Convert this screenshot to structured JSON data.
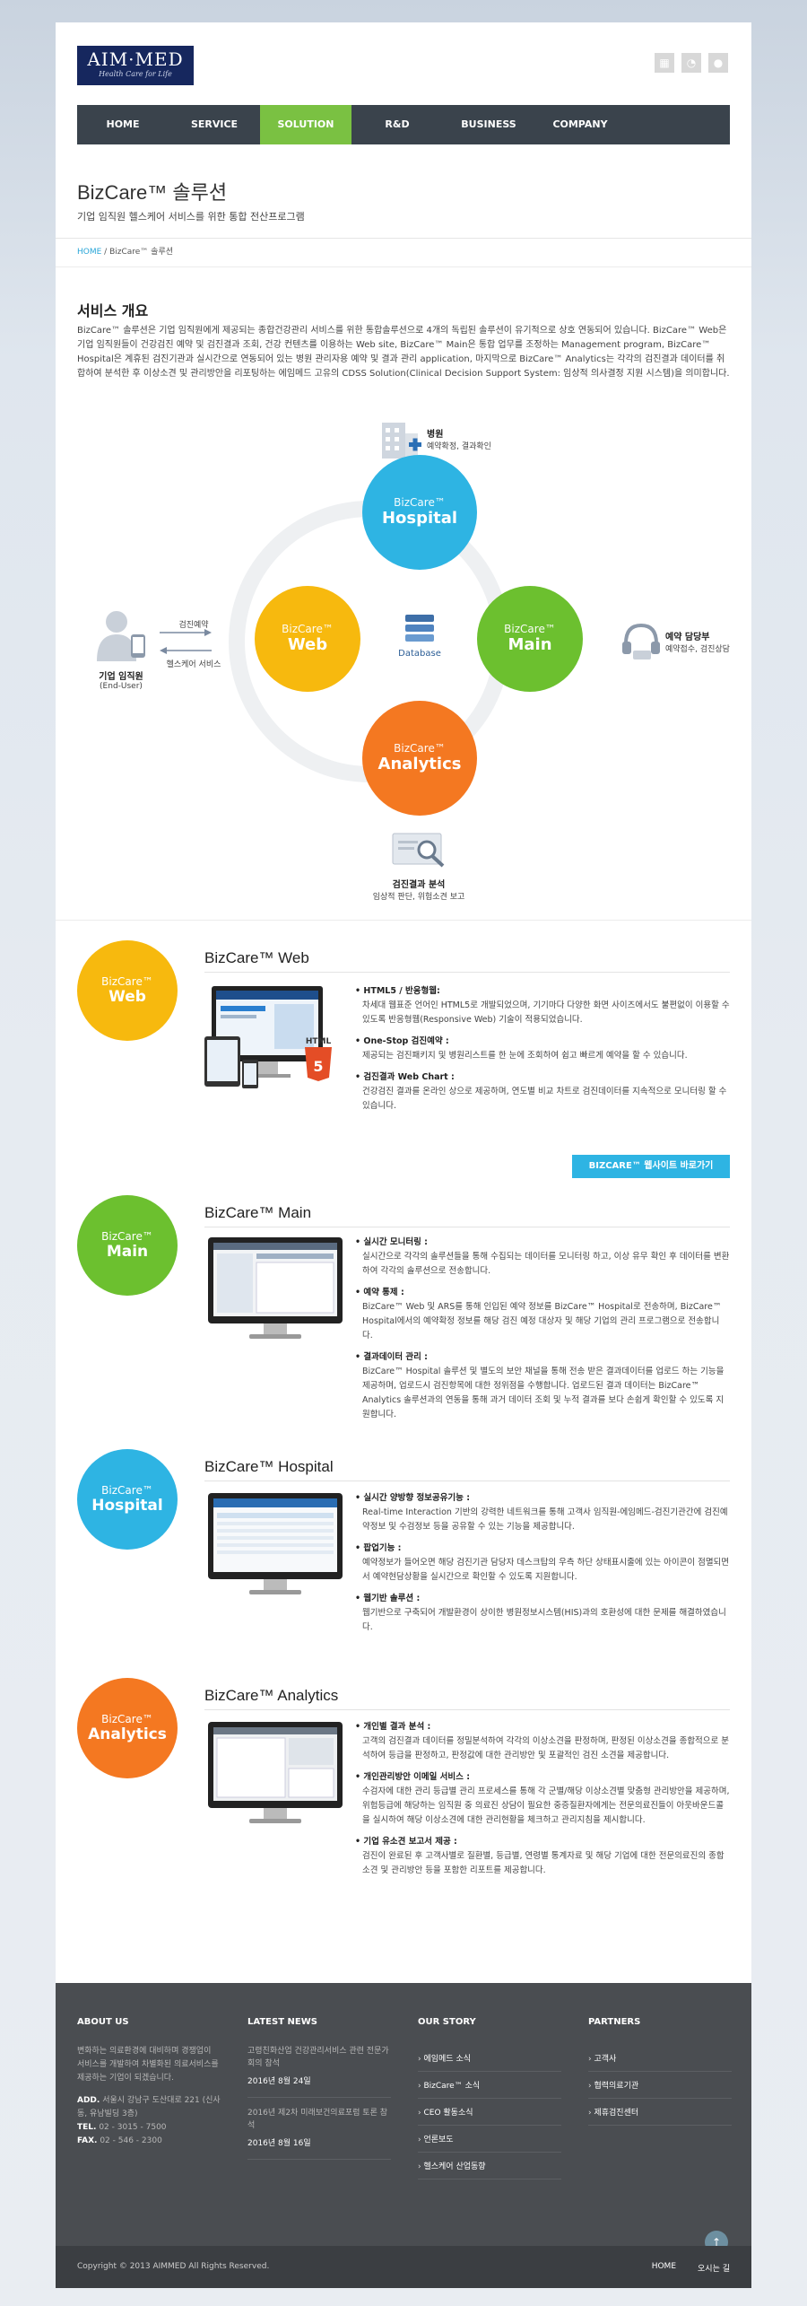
{
  "header": {
    "logo_main": "AIM·MED",
    "logo_sub": "Health Care for Life",
    "icons": [
      "calendar-icon",
      "rss-icon",
      "map-pin-icon"
    ]
  },
  "nav": {
    "items": [
      "HOME",
      "SERVICE",
      "SOLUTION",
      "R&D",
      "BUSINESS",
      "COMPANY"
    ],
    "active": "SOLUTION"
  },
  "page": {
    "title": "BizCare™ 솔루션",
    "subtitle": "기업 임직원 헬스케어 서비스를 위한 통합 전산프로그램",
    "breadcrumb_home": "HOME",
    "breadcrumb_current": " / BizCare™ 솔루션"
  },
  "overview": {
    "heading": "서비스 개요",
    "text": "BizCare™ 솔루션은 기업 임직원에게 제공되는 종합건강관리 서비스를 위한 통합솔루션으로 4개의 독립된 솔루션이 유기적으로 상호 연동되어 있습니다. BizCare™ Web은 기업 임직원들이 건강검진 예약 및 검진결과 조회, 건강 컨텐츠를 이용하는 Web site, BizCare™ Main은 통합 업무를 조정하는 Management program, BizCare™ Hospital은 계휴된 검진기관과 실시간으로 연동되어 있는 병원 관리자용 예약 및 결과 관리 application, 마지막으로 BizCare™ Analytics는 각각의 검진결과 데이터를 취합하여 분석한 후 이상소견 및 관리방안을 리포팅하는 에임메드 고유의 CDSS Solution(Clinical Decision Support System: 임상적 의사결정 지원 시스템)을 의미합니다."
  },
  "diagram": {
    "brand": "BizCare™",
    "hospital": "Hospital",
    "web": "Web",
    "main": "Main",
    "analytics": "Analytics",
    "database": "Database",
    "hospital_label": "병원",
    "hospital_desc": "예약확정, 결과확인",
    "user_label": "기업 임직원",
    "user_sub": "(End-User)",
    "arrow_top": "검진예약",
    "arrow_bottom": "헬스케어 서비스",
    "agent_label": "예약 담당부",
    "agent_desc": "예약접수, 검진상담",
    "analysis_label": "검진결과 분석",
    "analysis_desc": "임상적 판단, 위험소견 보고"
  },
  "sections": {
    "web": {
      "brand": "BizCare™",
      "name": "Web",
      "title": "BizCare™ Web",
      "b1_t": "HTML5 / 반응형웹:",
      "b1_d": "차세대 웹표준 언어인 HTML5로 개발되었으며, 기기마다 다양한 화면 사이즈에서도 불편없이 이용할 수 있도록 반응형웹(Responsive Web) 기술이 적용되었습니다.",
      "b2_t": "One-Stop 검진예약 :",
      "b2_d": "제공되는 검진패키지 및 병원리스트를 한 눈에 조회하여 쉽고 빠르게 예약을 할 수 있습니다.",
      "b3_t": "검진결과 Web Chart :",
      "b3_d": "건강검진 결과를 온라인 상으로 제공하며, 연도별 비교 차트로 검진데이터를 지속적으로 모니터링 할 수 있습니다.",
      "cta": "BIZCARE™ 웹사이트 바로가기"
    },
    "main": {
      "brand": "BizCare™",
      "name": "Main",
      "title": "BizCare™ Main",
      "b1_t": "실시간 모니터링 :",
      "b1_d": "실시간으로 각각의 솔루션들을 통해 수집되는 데이터를 모니터링 하고, 이상 유무 확인 후 데이터를 변환하여 각각의 솔루션으로 전송합니다.",
      "b2_t": "예약 통제 :",
      "b2_d": "BizCare™ Web 및 ARS를 통해 인입된 예약 정보를 BizCare™ Hospital로 전송하며, BizCare™ Hospital에서의 예약확정 정보를 해당 검진 예정 대상자 및 해당 기업의 관리 프로그램으로 전송합니다.",
      "b3_t": "결과데이터 관리 :",
      "b3_d": "BizCare™ Hospital 솔루션 및 별도의 보안 채널을 통해 전송 받은 결과데이터를 업로드 하는 기능을 제공하며, 업로드시 검진항목에 대한 정위점을 수행합니다. 업로드된 결과 데이터는 BizCare™ Analytics 솔루션과의 연동을 통해 과거 데이터 조회 및 누적 결과를 보다 손쉽게 확인할 수 있도록 지원합니다."
    },
    "hospital": {
      "brand": "BizCare™",
      "name": "Hospital",
      "title": "BizCare™ Hospital",
      "b1_t": "실시간 양방향 정보공유기능 :",
      "b1_d": "Real-time Interaction 기반의 강력한 네트워크를 통해 고객사 임직원-에임메드-검진기관간에 검진예약정보 및 수검정보 등을 공유할 수 있는 기능을 제공합니다.",
      "b2_t": "팝업기능 :",
      "b2_d": "예약정보가 들어오면 해당 검진기관 담당자 데스크탑의 우측 하단 상태표시줄에 있는 아이콘이 점멸되면서 예약현담상황을 실시간으로 확인할 수 있도록 지원합니다.",
      "b3_t": "웹기반 솔루션 :",
      "b3_d": "웹기반으로 구축되어 개발환경이 상이한 병원정보시스템(HIS)과의 호환성에 대한 문제를 해결하였습니다."
    },
    "analytics": {
      "brand": "BizCare™",
      "name": "Analytics",
      "title": "BizCare™ Analytics",
      "b1_t": "개인별 결과 분석 :",
      "b1_d": "고객의 검진결과 데이터를 정밀분석하여 각각의 이상소견을 판정하며, 판정된 이상소견을 종합적으로 분석하여 등급을 판정하고, 판정값에 대한 관리방안 및 포괄적인 검진 소견을 제공합니다.",
      "b2_t": "개인관리방안 이메일 서비스 :",
      "b2_d": "수검자에 대한 관리 등급별 관리 프로세스를 통해 각 군별/해당 이상소견별 맞춤형 관리방안을 제공하며, 위험등급에 해당하는 임직원 중 의료진 상담이 필요한 중증질환자에게는 전문의료진들이 아웃바운드콜을 실시하여 해당 이상소견에 대한 관리현황을 체크하고 관리지침을 제시합니다.",
      "b3_t": "기업 유소견 보고서 제공 :",
      "b3_d": "검진이 완료된 후 고객사별로 질환별, 등급별, 연령별 통계자료 및 해당 기업에 대한 전문의료진의 종합소견 및 관리방안 등을 포함한 리포트를 제공합니다."
    }
  },
  "footer": {
    "about_title": "ABOUT US",
    "about_text": "변화하는 의료환경에 대비하며 경쟁업이 서비스를 개발하여 차별화된 의료서비스를 제공하는 기업이 되겠습니다.",
    "addr_label": "ADD.",
    "addr_value": "서울시 강남구 도산대로 221 (신사동, 유남빌딩 3층)",
    "tel_label": "TEL.",
    "tel_value": "02 - 3015 - 7500",
    "fax_label": "FAX.",
    "fax_value": "02 - 546 - 2300",
    "news_title": "LATEST NEWS",
    "news": [
      {
        "text": "고령친화산업 건강관리서비스 관련 전문가 회의 참석",
        "date": "2016년 8월 24일"
      },
      {
        "text": "2016년 제2차 미래보건의료포럼 토론 참석",
        "date": "2016년 8월 16일"
      }
    ],
    "story_title": "OUR STORY",
    "story": [
      "에임메드 소식",
      "BizCare™ 소식",
      "CEO 활동소식",
      "언론보도",
      "헬스케어 산업동향"
    ],
    "partners_title": "PARTNERS",
    "partners": [
      "고객사",
      "협력의료기관",
      "제휴검진센터"
    ],
    "copyright": "Copyright © 2013 AIMMED All Rights Reserved.",
    "bottom_nav": [
      "HOME",
      "오시는 길"
    ]
  },
  "colors": {
    "blue": "#2eb4e3",
    "green": "#6cc02f",
    "yellow": "#f7b90e",
    "orange": "#f47821",
    "nav_bg": "#3a434c",
    "nav_active": "#7ac142"
  }
}
